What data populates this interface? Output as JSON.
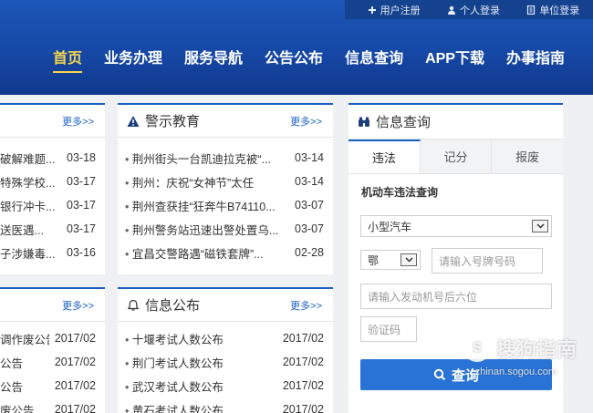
{
  "topbar": {
    "register": "用户注册",
    "personal_login": "个人登录",
    "unit_login": "单位登录"
  },
  "nav": [
    "首页",
    "业务办理",
    "服务导航",
    "公告公布",
    "信息查询",
    "APP下载",
    "办事指南"
  ],
  "left_top": {
    "more": "更多>>",
    "items": [
      {
        "text": "破解难题...",
        "date": "03-18"
      },
      {
        "text": "特殊学校...",
        "date": "03-17"
      },
      {
        "text": "银行冲卡...",
        "date": "03-17"
      },
      {
        "text": "送医遇...",
        "date": "03-17"
      },
      {
        "text": "子涉嫌毒...",
        "date": "03-16"
      }
    ]
  },
  "warning": {
    "title": "警示教育",
    "more": "更多>>",
    "items": [
      {
        "text": "荆州街头一台凯迪拉克被“...",
        "date": "03-14"
      },
      {
        "text": "荆州：庆祝“女神节”太任",
        "date": "03-14"
      },
      {
        "text": "荆州查获挂“狂奔牛B74110...",
        "date": "03-07"
      },
      {
        "text": "荆州警务站迅速出警处置乌...",
        "date": "03-07"
      },
      {
        "text": "宜昌交警路遇“磁铁套牌”...",
        "date": "02-28"
      }
    ]
  },
  "left_bottom": {
    "more": "更多>>",
    "items": [
      {
        "text": "调作废公告",
        "date": "2017/02"
      },
      {
        "text": "公告",
        "date": "2017/02"
      },
      {
        "text": "公告",
        "date": "2017/02"
      },
      {
        "text": "废公告",
        "date": "2017/02"
      }
    ]
  },
  "info": {
    "title": "信息公布",
    "more": "更多>>",
    "items": [
      {
        "text": "十堰考试人数公布",
        "date": "2017/02"
      },
      {
        "text": "荆门考试人数公布",
        "date": "2017/02"
      },
      {
        "text": "武汉考试人数公布",
        "date": "2017/02"
      },
      {
        "text": "黄石考试人数公布",
        "date": "2017/02"
      }
    ]
  },
  "query": {
    "title": "信息查询",
    "tabs": [
      "违法",
      "记分",
      "报废"
    ],
    "subtitle": "机动车违法查询",
    "vehicle_type": "小型汽车",
    "province": "鄂",
    "plate_placeholder": "请输入号牌号码",
    "engine_placeholder": "请输入发动机号后六位",
    "captcha_placeholder": "验证码",
    "button": "查询"
  },
  "watermark": {
    "text": "搜狗指南",
    "url": "zhinan.sogou.com"
  },
  "colors": {
    "header": "#1648a6",
    "accent": "#1a5fc4",
    "active_nav": "#f7d54a",
    "button": "#2a73d6"
  }
}
